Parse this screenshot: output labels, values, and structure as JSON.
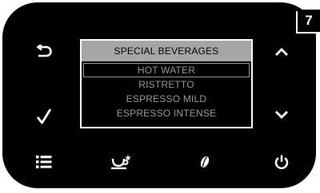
{
  "step_number": "7",
  "display": {
    "header": "SPECIAL BEVERAGES",
    "items": [
      {
        "label": "HOT WATER",
        "selected": true
      },
      {
        "label": "RISTRETTO",
        "selected": false
      },
      {
        "label": "ESPRESSO MILD",
        "selected": false
      },
      {
        "label": "ESPRESSO INTENSE",
        "selected": false
      }
    ]
  },
  "buttons": {
    "back": "back-arrow-icon",
    "confirm": "checkmark-icon",
    "menu": "list-icon",
    "up": "chevron-up-icon",
    "down": "chevron-down-icon",
    "favorite_cup": "cup-star-icon",
    "bean": "coffee-bean-icon",
    "power": "power-icon"
  },
  "colors": {
    "panel": "#000000",
    "icon": "#ffffff",
    "header_bg": "#a6a6a6",
    "item_text": "#9b9b9b"
  }
}
